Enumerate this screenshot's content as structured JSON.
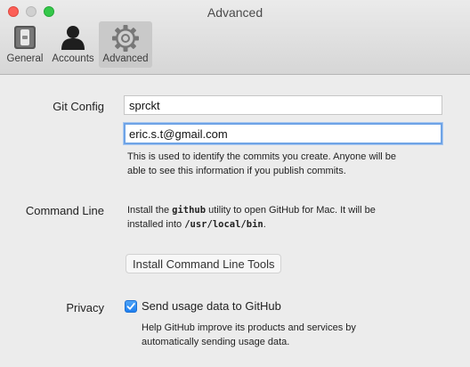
{
  "window": {
    "title": "Advanced"
  },
  "toolbar": {
    "items": [
      {
        "label": "General",
        "icon": "phone-switch-icon"
      },
      {
        "label": "Accounts",
        "icon": "person-icon"
      },
      {
        "label": "Advanced",
        "icon": "gear-icon",
        "selected": true
      }
    ]
  },
  "git_config": {
    "label": "Git Config",
    "name_value": "sprckt",
    "email_value": "eric.s.t@gmail.com",
    "help": [
      "This is used to identify the commits you create. Anyone will be",
      "able to see this information if you publish commits."
    ]
  },
  "command_line": {
    "label": "Command Line",
    "line1_pre": "Install the ",
    "line1_code": "github",
    "line1_post": " utility to open GitHub for Mac. It will be",
    "line2_pre": "installed into ",
    "line2_code": "/usr/local/bin",
    "line2_post": ".",
    "button_label": "Install Command Line Tools"
  },
  "privacy": {
    "label": "Privacy",
    "checkbox_label": "Send usage data to GitHub",
    "checked": true,
    "help": [
      "Help GitHub improve its products and services by",
      "automatically sending usage data."
    ]
  },
  "colors": {
    "accent": "#1f7ff0",
    "focus_ring": "#6ea3e6"
  }
}
